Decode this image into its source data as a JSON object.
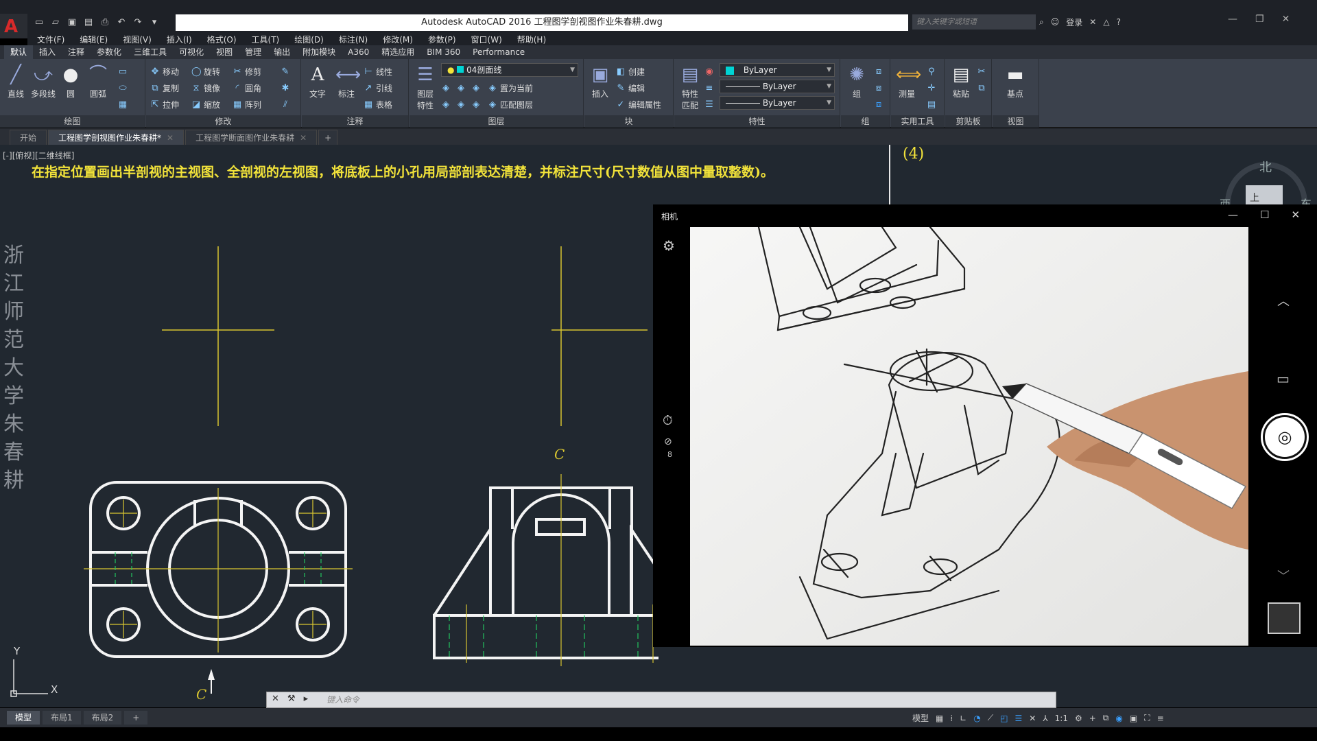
{
  "titlebar": {
    "window_title": "Autodesk AutoCAD 2016    工程图学剖视图作业朱春耕.dwg",
    "search_placeholder": "键入关键字或短语",
    "login_label": "登录"
  },
  "menu": [
    "文件(F)",
    "编辑(E)",
    "视图(V)",
    "插入(I)",
    "格式(O)",
    "工具(T)",
    "绘图(D)",
    "标注(N)",
    "修改(M)",
    "参数(P)",
    "窗口(W)",
    "帮助(H)"
  ],
  "ribbon_tabs": [
    "默认",
    "插入",
    "注释",
    "参数化",
    "三维工具",
    "可视化",
    "视图",
    "管理",
    "输出",
    "附加模块",
    "A360",
    "精选应用",
    "BIM 360",
    "Performance"
  ],
  "ribbon": {
    "draw": {
      "title": "绘图",
      "line": "直线",
      "polyline": "多段线",
      "circle": "圆",
      "arc": "圆弧"
    },
    "modify": {
      "title": "修改",
      "move": "移动",
      "rotate": "旋转",
      "trim": "修剪",
      "copy": "复制",
      "mirror": "镜像",
      "fillet": "圆角",
      "stretch": "拉伸",
      "scale": "缩放",
      "array": "阵列"
    },
    "annotation": {
      "title": "注释",
      "text": "文字",
      "dimension": "标注",
      "linear": "线性",
      "leader": "引线",
      "table": "表格"
    },
    "layers": {
      "title": "图层",
      "layer_props_1": "图层",
      "layer_props_2": "特性",
      "current_layer": "04剖面线",
      "make_current": "置为当前",
      "match_layer": "匹配图层"
    },
    "block": {
      "title": "块",
      "insert": "插入",
      "create": "创建",
      "edit": "编辑",
      "edit_attr": "编辑属性"
    },
    "properties": {
      "title": "特性",
      "match_1": "特性",
      "match_2": "匹配",
      "color": "ByLayer",
      "linetype": "ByLayer",
      "lineweight": "ByLayer"
    },
    "groups": {
      "title": "组",
      "group": "组"
    },
    "utilities": {
      "title": "实用工具",
      "measure": "测量"
    },
    "clipboard": {
      "title": "剪贴板",
      "paste": "粘贴"
    },
    "view": {
      "title": "视图",
      "base": "基点"
    }
  },
  "doc_tabs": [
    {
      "label": "开始"
    },
    {
      "label": "工程图学剖视图作业朱春耕*"
    },
    {
      "label": "工程图学断面图作业朱春耕"
    }
  ],
  "drawing": {
    "viewport_label": "[-][俯视][二维线框]",
    "instruction": "在指定位置画出半剖视的主视图、全剖视的左视图，将底板上的小孔用局部剖表达清楚，并标注尺寸(尺寸数值从图中量取整数)。",
    "part_label": "(4)",
    "vertical_text": [
      "浙",
      "江",
      "师",
      "范",
      "大",
      "学",
      "朱",
      "春",
      "耕"
    ],
    "section_mark_top": "C",
    "section_mark_bottom": "C",
    "viewcube": {
      "north": "北",
      "west": "西",
      "east": "东",
      "face": "上"
    },
    "ucs": {
      "x": "X",
      "y": "Y"
    }
  },
  "camera": {
    "title": "相机",
    "burst_count": "8"
  },
  "command_line": {
    "placeholder": "键入命令"
  },
  "layout_tabs": [
    "模型",
    "布局1",
    "布局2"
  ],
  "status": {
    "model": "模型",
    "scale": "1:1"
  },
  "colors": {
    "drawing_bg": "#212830",
    "yellow": "#f2e33a",
    "accent": "#3aa0ff"
  }
}
